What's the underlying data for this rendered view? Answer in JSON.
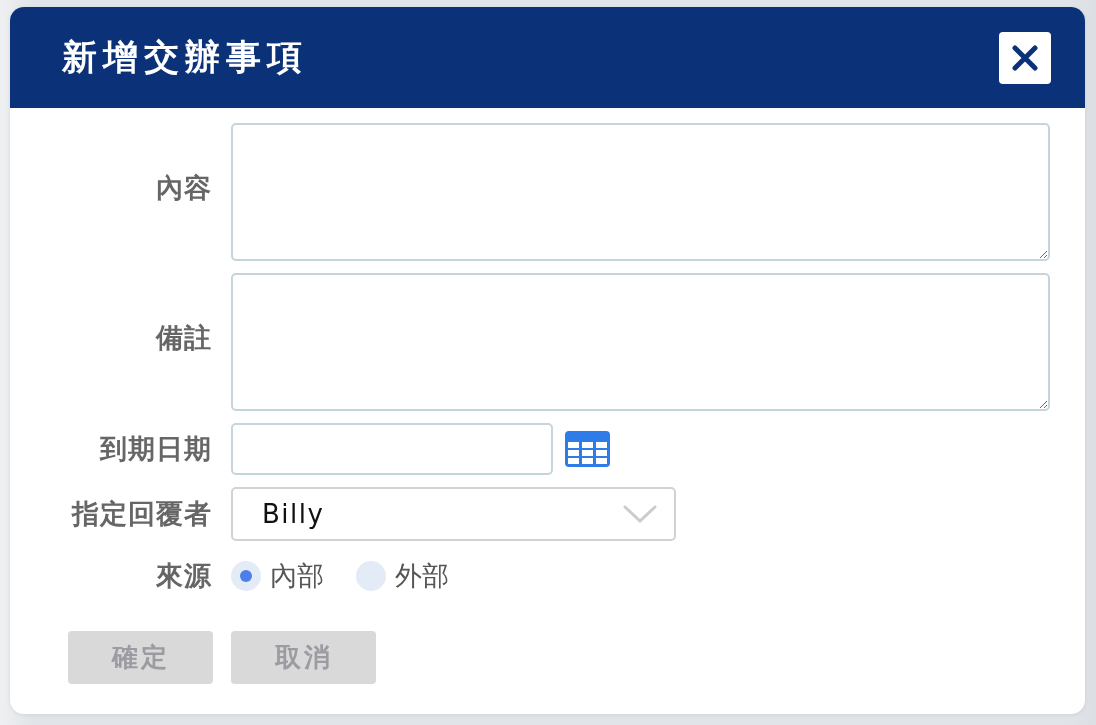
{
  "dialog": {
    "title": "新增交辦事項"
  },
  "fields": [
    {
      "kind": "textarea",
      "label": "內容"
    },
    {
      "kind": "textarea",
      "label": "備註"
    },
    {
      "kind": "date",
      "label": "到期日期"
    },
    {
      "kind": "select",
      "label": "指定回覆者",
      "value": "Billy"
    },
    {
      "kind": "radio",
      "label": "來源",
      "options": [
        {
          "label": "內部",
          "selected": true
        },
        {
          "label": "外部",
          "selected": false
        }
      ]
    }
  ],
  "buttons": [
    {
      "label": "確定",
      "disabled": true
    },
    {
      "label": "取消",
      "disabled": true
    }
  ]
}
